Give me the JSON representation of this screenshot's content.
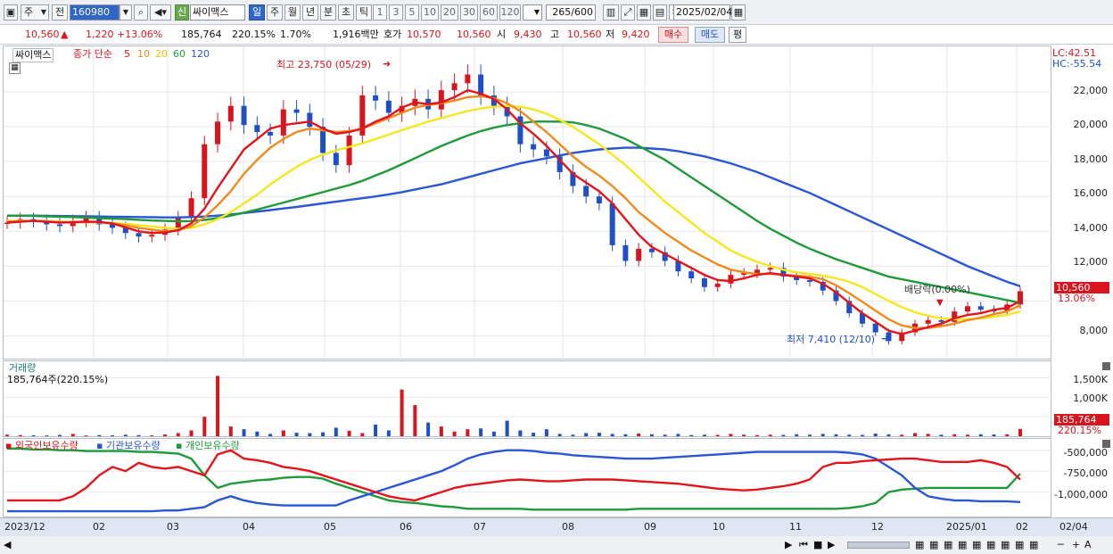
{
  "toolbar": {
    "period": "주",
    "prev_label": "전",
    "code": "160980",
    "credit_badge": "신",
    "name": "싸이맥스",
    "period_tabs": [
      "일",
      "주",
      "월",
      "년",
      "분",
      "초",
      "틱"
    ],
    "minute_opts": [
      "1",
      "3",
      "5",
      "10",
      "20",
      "30",
      "60",
      "120"
    ],
    "count": "265",
    "count_total": "/600",
    "date": "2025/02/04"
  },
  "quote": {
    "price": "10,560",
    "change": "1,220",
    "change_pct": "+13.06%",
    "volume": "185,764",
    "volume_pct": "220.15%",
    "turnover_pct": "1.70%",
    "amount": "1,916백만",
    "hoga_label": "호가",
    "hoga_ask": "10,570",
    "hoga_bid": "10,560",
    "open_label": "시",
    "open": "9,430",
    "high_label": "고",
    "high": "10,560",
    "low_label": "저",
    "low": "9,420",
    "buy_label": "매수",
    "sell_label": "매도",
    "eval_label": "평"
  },
  "price_panel": {
    "stock_tab": "싸이맥스",
    "legend": [
      "종가 단순",
      "5",
      "10",
      "20",
      "60",
      "120"
    ],
    "lc": "LC:42.51",
    "hc": "HC:-55.54",
    "y_ticks": [
      "22,000",
      "20,000",
      "18,000",
      "16,000",
      "14,000",
      "12,000",
      "10,000",
      "8,000"
    ],
    "current_price": "10,560",
    "current_pct": "13.06%",
    "high_marker": "최고 23,750 (05/29)",
    "low_marker": "최저 7,410 (12/10)",
    "dividend_marker": "배당락(0.00%)"
  },
  "volume_panel": {
    "title": "거래량",
    "value": "185,764주(220.15%)",
    "y_ticks": [
      "1,500K",
      "1,000K",
      "500,000"
    ],
    "current": "185,764",
    "current_pct": "220.15%"
  },
  "holdings_panel": {
    "legend": [
      "외국인보유수량",
      "기관보유수량",
      "개인보유수량"
    ],
    "y_ticks": [
      "-500,000",
      "-750,000",
      "-1,000,000"
    ]
  },
  "x_axis": {
    "labels": [
      "2023/12",
      "02",
      "03",
      "04",
      "05",
      "06",
      "07",
      "08",
      "09",
      "10",
      "11",
      "12",
      "2025/01",
      "02"
    ],
    "right_label": "02/04"
  },
  "colors": {
    "ma5": "#e4141c",
    "ma10": "#f08a1c",
    "ma20": "#f5e61e",
    "ma60": "#1e9a3a",
    "ma120": "#2a56d6",
    "up": "#d8141e",
    "down": "#1f4fc7"
  },
  "chart_data": {
    "type": "candlestick",
    "period": "weekly",
    "x_labels": [
      "2023/12",
      "02",
      "03",
      "04",
      "05",
      "06",
      "07",
      "08",
      "09",
      "10",
      "11",
      "12",
      "2025/01",
      "02"
    ],
    "y_range": [
      7000,
      24000
    ],
    "close": [
      14500,
      14700,
      14600,
      14400,
      14300,
      14600,
      14800,
      14400,
      14200,
      13900,
      13700,
      13800,
      14100,
      14800,
      15900,
      19000,
      20300,
      21200,
      20100,
      19700,
      19500,
      21000,
      20800,
      20000,
      18500,
      17800,
      19500,
      21800,
      21500,
      20800,
      21200,
      21600,
      21000,
      22100,
      22500,
      23000,
      21800,
      21200,
      20600,
      19000,
      18700,
      18300,
      17400,
      16600,
      16000,
      15600,
      13200,
      12300,
      13000,
      12800,
      12300,
      11700,
      11300,
      10800,
      11000,
      11500,
      11600,
      11800,
      11900,
      11400,
      11200,
      11100,
      10600,
      10000,
      9300,
      8700,
      8200,
      7700,
      8200,
      8700,
      8900,
      8800,
      9400,
      9700,
      9500,
      9400,
      9800,
      10560
    ],
    "ma5": [
      14500,
      14550,
      14600,
      14550,
      14500,
      14520,
      14560,
      14540,
      14450,
      14230,
      14000,
      13900,
      13940,
      14060,
      14460,
      15300,
      16500,
      17600,
      18700,
      19300,
      19900,
      20100,
      20200,
      20300,
      19900,
      19600,
      19700,
      19900,
      20300,
      20600,
      21100,
      21400,
      21300,
      21400,
      21700,
      22100,
      21900,
      21600,
      21000,
      20200,
      19600,
      18900,
      18100,
      17300,
      16800,
      16300,
      15600,
      14700,
      13800,
      13100,
      12700,
      12300,
      11900,
      11500,
      11200,
      11150,
      11300,
      11500,
      11600,
      11500,
      11400,
      11300,
      11000,
      10500,
      9900,
      9300,
      8800,
      8300,
      8100,
      8300,
      8500,
      8700,
      9000,
      9200,
      9300,
      9500,
      9600,
      10000
    ],
    "ma10": [
      14550,
      14580,
      14600,
      14570,
      14530,
      14520,
      14530,
      14510,
      14460,
      14360,
      14200,
      14100,
      14000,
      14050,
      14300,
      14800,
      15500,
      16300,
      17300,
      18100,
      18800,
      19300,
      19700,
      19900,
      19800,
      19700,
      19750,
      19900,
      20200,
      20500,
      20800,
      21100,
      21250,
      21350,
      21500,
      21700,
      21750,
      21650,
      21350,
      20900,
      20300,
      19700,
      19000,
      18300,
      17700,
      17200,
      16600,
      15900,
      15100,
      14500,
      13900,
      13400,
      12900,
      12500,
      12100,
      11800,
      11650,
      11550,
      11550,
      11500,
      11450,
      11400,
      11250,
      10900,
      10450,
      9950,
      9450,
      8950,
      8600,
      8450,
      8450,
      8550,
      8700,
      8900,
      9050,
      9250,
      9400,
      9750
    ],
    "ma20": [
      14600,
      14600,
      14600,
      14590,
      14560,
      14540,
      14530,
      14510,
      14480,
      14430,
      14360,
      14280,
      14200,
      14150,
      14200,
      14400,
      14700,
      15100,
      15600,
      16100,
      16700,
      17200,
      17700,
      18100,
      18400,
      18650,
      18850,
      19050,
      19300,
      19550,
      19800,
      20050,
      20300,
      20500,
      20700,
      20900,
      21050,
      21150,
      21200,
      21150,
      21000,
      20750,
      20400,
      20000,
      19500,
      19000,
      18400,
      17800,
      17100,
      16400,
      15700,
      15100,
      14500,
      13900,
      13400,
      12900,
      12550,
      12250,
      12000,
      11800,
      11650,
      11550,
      11450,
      11300,
      11100,
      10800,
      10400,
      10000,
      9650,
      9350,
      9150,
      9000,
      8950,
      8950,
      9000,
      9100,
      9200,
      9400
    ],
    "ma60": [
      14900,
      14900,
      14880,
      14860,
      14840,
      14820,
      14790,
      14760,
      14730,
      14700,
      14660,
      14620,
      14600,
      14580,
      14590,
      14650,
      14760,
      14900,
      15070,
      15250,
      15450,
      15650,
      15850,
      16050,
      16250,
      16450,
      16650,
      16900,
      17200,
      17500,
      17850,
      18200,
      18550,
      18900,
      19200,
      19500,
      19750,
      19950,
      20100,
      20200,
      20300,
      20300,
      20300,
      20250,
      20100,
      19900,
      19600,
      19300,
      18900,
      18500,
      18100,
      17600,
      17100,
      16600,
      16100,
      15600,
      15100,
      14600,
      14150,
      13750,
      13350,
      13000,
      12700,
      12400,
      12150,
      11900,
      11650,
      11400,
      11250,
      11100,
      10950,
      10800,
      10650,
      10500,
      10350,
      10200,
      10050,
      9900
    ],
    "ma120": [
      14900,
      14900,
      14900,
      14890,
      14880,
      14870,
      14860,
      14850,
      14840,
      14830,
      14820,
      14810,
      14800,
      14800,
      14820,
      14850,
      14900,
      14970,
      15050,
      15130,
      15220,
      15310,
      15400,
      15500,
      15600,
      15700,
      15800,
      15900,
      16000,
      16120,
      16250,
      16400,
      16550,
      16700,
      16900,
      17100,
      17300,
      17500,
      17700,
      17900,
      18050,
      18200,
      18350,
      18500,
      18600,
      18700,
      18750,
      18800,
      18800,
      18750,
      18700,
      18600,
      18450,
      18300,
      18100,
      17900,
      17650,
      17400,
      17100,
      16800,
      16500,
      16200,
      15850,
      15500,
      15150,
      14800,
      14450,
      14100,
      13750,
      13400,
      13050,
      12700,
      12350,
      12000,
      11700,
      11400,
      11100,
      10850
    ],
    "volume_k": [
      40,
      30,
      25,
      20,
      35,
      60,
      20,
      30,
      25,
      40,
      30,
      20,
      45,
      80,
      150,
      500,
      1550,
      250,
      180,
      120,
      60,
      150,
      90,
      80,
      100,
      220,
      140,
      80,
      300,
      150,
      1200,
      800,
      350,
      250,
      120,
      180,
      200,
      120,
      400,
      150,
      90,
      180,
      60,
      40,
      80,
      90,
      60,
      50,
      70,
      50,
      40,
      60,
      30,
      40,
      35,
      60,
      40,
      30,
      40,
      35,
      50,
      40,
      60,
      50,
      40,
      35,
      70,
      50,
      40,
      80,
      60,
      40,
      50,
      40,
      50,
      45,
      50,
      186
    ],
    "foreign_qty": [
      -1100000,
      -1100000,
      -1100000,
      -1100000,
      -1100000,
      -1050000,
      -950000,
      -800000,
      -700000,
      -750000,
      -650000,
      -700000,
      -720000,
      -700000,
      -750000,
      -800000,
      -550000,
      -500000,
      -600000,
      -620000,
      -650000,
      -700000,
      -720000,
      -750000,
      -800000,
      -850000,
      -900000,
      -950000,
      -1000000,
      -1050000,
      -1080000,
      -1100000,
      -1050000,
      -1000000,
      -950000,
      -920000,
      -900000,
      -880000,
      -860000,
      -850000,
      -860000,
      -870000,
      -870000,
      -860000,
      -850000,
      -850000,
      -850000,
      -860000,
      -870000,
      -880000,
      -890000,
      -900000,
      -920000,
      -940000,
      -960000,
      -970000,
      -980000,
      -970000,
      -950000,
      -930000,
      -900000,
      -850000,
      -700000,
      -650000,
      -650000,
      -630000,
      -620000,
      -610000,
      -600000,
      -600000,
      -620000,
      -640000,
      -640000,
      -640000,
      -620000,
      -650000,
      -700000,
      -850000
    ],
    "institution_qty": [
      -1230000,
      -1230000,
      -1230000,
      -1230000,
      -1230000,
      -1230000,
      -1230000,
      -1230000,
      -1230000,
      -1230000,
      -1230000,
      -1230000,
      -1220000,
      -1220000,
      -1200000,
      -1180000,
      -1100000,
      -1050000,
      -1100000,
      -1130000,
      -1150000,
      -1160000,
      -1160000,
      -1160000,
      -1160000,
      -1160000,
      -1100000,
      -1050000,
      -1000000,
      -950000,
      -900000,
      -850000,
      -800000,
      -750000,
      -680000,
      -600000,
      -550000,
      -520000,
      -500000,
      -500000,
      -510000,
      -530000,
      -540000,
      -560000,
      -570000,
      -580000,
      -590000,
      -600000,
      -600000,
      -600000,
      -590000,
      -580000,
      -570000,
      -560000,
      -550000,
      -540000,
      -530000,
      -520000,
      -520000,
      -520000,
      -520000,
      -520000,
      -520000,
      -520000,
      -530000,
      -550000,
      -600000,
      -700000,
      -800000,
      -950000,
      -1050000,
      -1080000,
      -1100000,
      -1100000,
      -1110000,
      -1110000,
      -1110000,
      -1120000
    ],
    "individual_qty": [
      -480000,
      -480000,
      -490000,
      -490000,
      -500000,
      -500000,
      -510000,
      -510000,
      -510000,
      -510000,
      -520000,
      -520000,
      -530000,
      -540000,
      -600000,
      -800000,
      -950000,
      -900000,
      -880000,
      -860000,
      -850000,
      -830000,
      -820000,
      -820000,
      -840000,
      -900000,
      -950000,
      -1000000,
      -1050000,
      -1100000,
      -1120000,
      -1130000,
      -1150000,
      -1170000,
      -1180000,
      -1200000,
      -1200000,
      -1200000,
      -1200000,
      -1200000,
      -1210000,
      -1210000,
      -1210000,
      -1210000,
      -1210000,
      -1210000,
      -1210000,
      -1210000,
      -1200000,
      -1200000,
      -1200000,
      -1200000,
      -1200000,
      -1200000,
      -1200000,
      -1200000,
      -1200000,
      -1200000,
      -1200000,
      -1200000,
      -1200000,
      -1200000,
      -1200000,
      -1200000,
      -1190000,
      -1170000,
      -1130000,
      -1000000,
      -970000,
      -960000,
      -950000,
      -950000,
      -950000,
      -950000,
      -950000,
      -950000,
      -950000,
      -780000
    ]
  }
}
